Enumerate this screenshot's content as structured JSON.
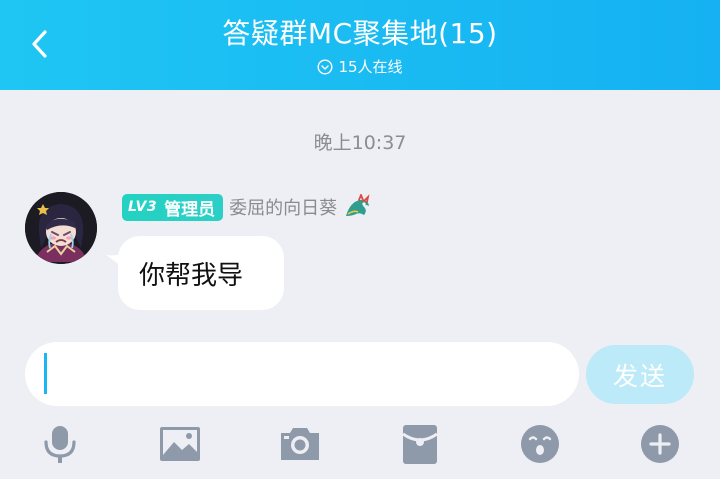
{
  "header": {
    "title": "答疑群MC聚集地(15)",
    "online": "15人在线",
    "back_icon": "chevron-left-icon",
    "status_icon": "chevron-down-circle-icon"
  },
  "chat": {
    "timestamp": "晚上10:37",
    "message": {
      "level": "LV3",
      "role": "管理员",
      "sender": "委屈的向日葵",
      "text": "你帮我导"
    }
  },
  "composer": {
    "input_value": "",
    "send_label": "发送"
  },
  "toolbar": {
    "icons": [
      "microphone-icon",
      "image-icon",
      "camera-icon",
      "red-packet-icon",
      "emoji-icon",
      "plus-icon"
    ]
  },
  "colors": {
    "header": "#15b1f2",
    "badge": "#23d2c2",
    "send_disabled": "#bdeaf8",
    "background": "#eeeef5",
    "tool_icon": "#8e9aa9"
  }
}
